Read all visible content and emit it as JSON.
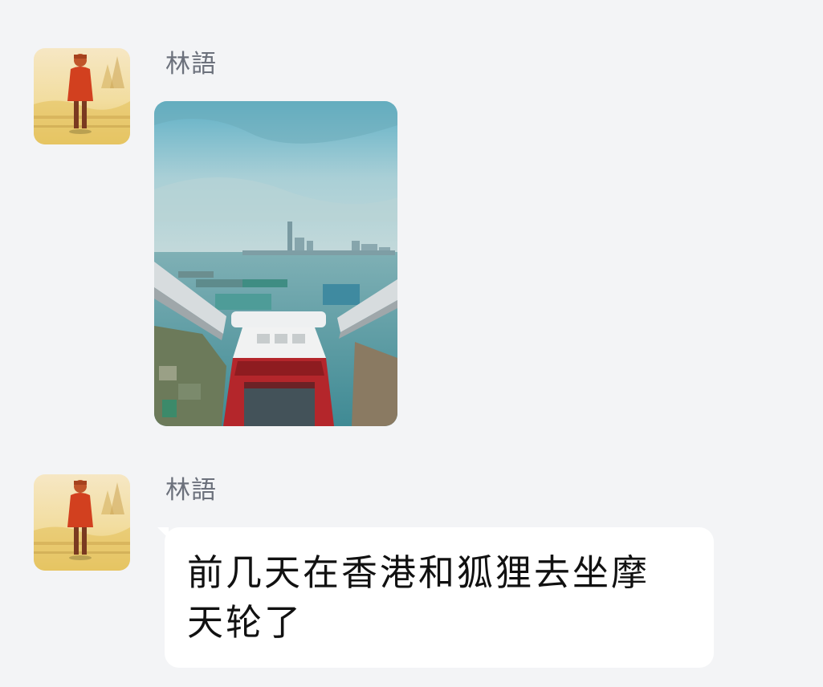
{
  "messages": [
    {
      "sender": "林語",
      "avatar_icon": "girl-in-red-illustration",
      "type": "image",
      "image_description_icon": "ferris-wheel-harbor-view-photo"
    },
    {
      "sender": "林語",
      "avatar_icon": "girl-in-red-illustration",
      "type": "text",
      "text": "前几天在香港和狐狸去坐摩天轮了"
    }
  ],
  "colors": {
    "background": "#f3f4f6",
    "bubble": "#ffffff",
    "sender_name": "#6c717c",
    "message_text": "#111111"
  }
}
